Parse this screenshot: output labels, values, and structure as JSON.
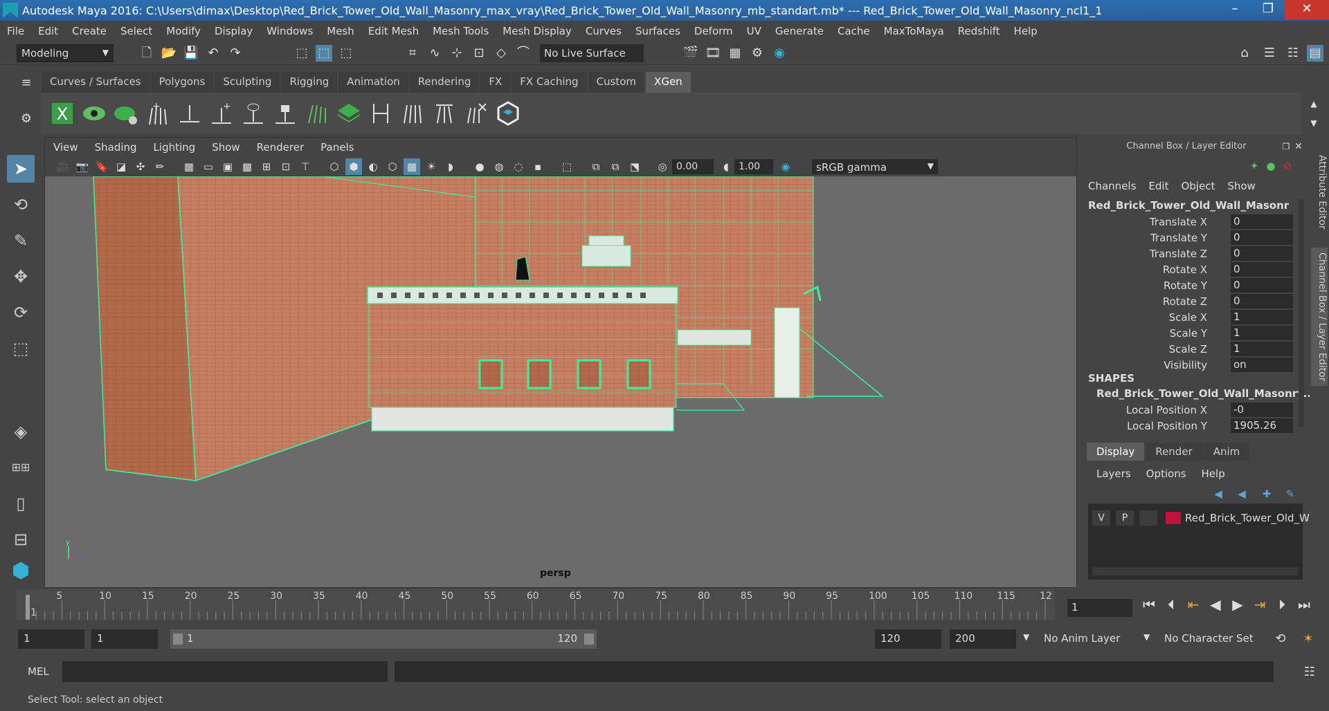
{
  "window": {
    "title": "Autodesk Maya 2016: C:\\Users\\dimax\\Desktop\\Red_Brick_Tower_Old_Wall_Masonry_max_vray\\Red_Brick_Tower_Old_Wall_Masonry_mb_standart.mb*   ---   Red_Brick_Tower_Old_Wall_Masonry_ncl1_1",
    "minimize": "–",
    "maximize": "❐",
    "close": "✕"
  },
  "menubar": [
    "File",
    "Edit",
    "Create",
    "Select",
    "Modify",
    "Display",
    "Windows",
    "Mesh",
    "Edit Mesh",
    "Mesh Tools",
    "Mesh Display",
    "Curves",
    "Surfaces",
    "Deform",
    "UV",
    "Generate",
    "Cache",
    "MaxToMaya",
    "Redshift",
    "Help"
  ],
  "statusline": {
    "mode": "Modeling",
    "live_surface": "No Live Surface"
  },
  "shelf": {
    "tabs": [
      "Curves / Surfaces",
      "Polygons",
      "Sculpting",
      "Rigging",
      "Animation",
      "Rendering",
      "FX",
      "FX Caching",
      "Custom",
      "XGen"
    ],
    "active_tab": "XGen"
  },
  "viewport": {
    "menu": [
      "View",
      "Shading",
      "Lighting",
      "Show",
      "Renderer",
      "Panels"
    ],
    "exposure": "0.00",
    "gamma_value": "1.00",
    "color_space": "sRGB gamma",
    "camera_label": "persp"
  },
  "channel_box": {
    "title": "Channel Box / Layer Editor",
    "menu": [
      "Channels",
      "Edit",
      "Object",
      "Show"
    ],
    "object_name": "Red_Brick_Tower_Old_Wall_Masonry_...",
    "attributes": [
      {
        "label": "Translate X",
        "value": "0"
      },
      {
        "label": "Translate Y",
        "value": "0"
      },
      {
        "label": "Translate Z",
        "value": "0"
      },
      {
        "label": "Rotate X",
        "value": "0"
      },
      {
        "label": "Rotate Y",
        "value": "0"
      },
      {
        "label": "Rotate Z",
        "value": "0"
      },
      {
        "label": "Scale X",
        "value": "1"
      },
      {
        "label": "Scale Y",
        "value": "1"
      },
      {
        "label": "Scale Z",
        "value": "1"
      },
      {
        "label": "Visibility",
        "value": "on"
      }
    ],
    "shapes_header": "SHAPES",
    "shape_name": "Red_Brick_Tower_Old_Wall_Masonry...",
    "shape_attributes": [
      {
        "label": "Local Position X",
        "value": "-0"
      },
      {
        "label": "Local Position Y",
        "value": "1905.26"
      }
    ]
  },
  "layer_editor": {
    "tabs": [
      "Display",
      "Render",
      "Anim"
    ],
    "active_tab": "Display",
    "menu": [
      "Layers",
      "Options",
      "Help"
    ],
    "layer": {
      "v": "V",
      "p": "P",
      "name": "Red_Brick_Tower_Old_W",
      "color": "#c0133b"
    }
  },
  "side_tabs": [
    "Attribute Editor",
    "Channel Box / Layer Editor"
  ],
  "timeline": {
    "ticks": [
      "1",
      "5",
      "10",
      "15",
      "20",
      "25",
      "30",
      "35",
      "40",
      "45",
      "50",
      "55",
      "60",
      "65",
      "70",
      "75",
      "80",
      "85",
      "90",
      "95",
      "100",
      "105",
      "110",
      "115",
      "12"
    ],
    "current_frame": "1"
  },
  "range": {
    "start": "1",
    "playback_start": "1",
    "slider_start": "1",
    "slider_end": "120",
    "playback_end": "120",
    "end": "200",
    "anim_layer": "No Anim Layer",
    "character_set": "No Character Set"
  },
  "command_line": {
    "label": "MEL"
  },
  "help_line": "Select Tool: select an object"
}
